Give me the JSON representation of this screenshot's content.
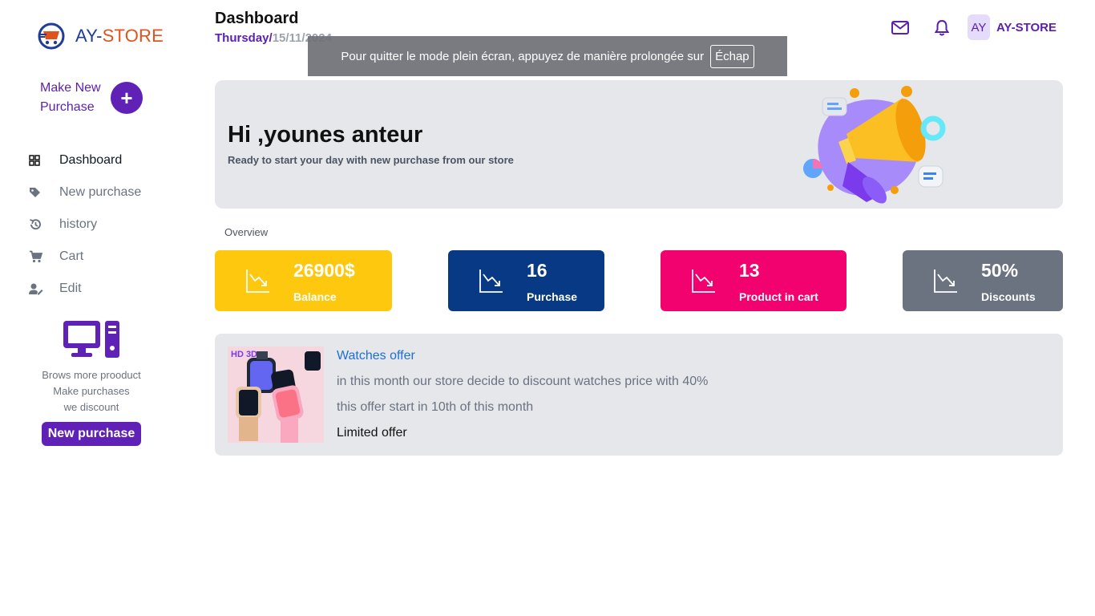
{
  "sidebar": {
    "logo": {
      "prefix": "AY-",
      "suffix": "STORE"
    },
    "make_new_label": "Make New Purchase",
    "make_new_plus": "+",
    "nav": [
      {
        "label": "Dashboard",
        "icon": "grid-icon"
      },
      {
        "label": "New purchase",
        "icon": "tag-icon"
      },
      {
        "label": "history",
        "icon": "history-icon"
      },
      {
        "label": "Cart",
        "icon": "cart-icon"
      },
      {
        "label": "Edit",
        "icon": "user-edit-icon"
      }
    ],
    "promo": {
      "line1": "Brows more prooduct",
      "line2": "Make purchases",
      "line3": "we discount",
      "button": "New purchase"
    }
  },
  "header": {
    "title": "Dashboard",
    "day": "Thursday",
    "separator": "/",
    "date": "15/11/2024",
    "avatar_initials": "AY",
    "store_name": "AY-STORE"
  },
  "toast": {
    "text": "Pour quitter le mode plein écran, appuyez de manière prolongée sur",
    "key": "Échap"
  },
  "banner": {
    "title": "Hi ,younes anteur",
    "subtitle": "Ready to start your day with new purchase from our store"
  },
  "overview": {
    "label": "Overview",
    "stats": [
      {
        "value": "26900$",
        "label": "Balance",
        "color": "#fdc80d"
      },
      {
        "value": "16",
        "label": "Purchase",
        "color": "#073985"
      },
      {
        "value": "13",
        "label": "Product in cart",
        "color": "#f2026f"
      },
      {
        "value": "50%",
        "label": "Discounts",
        "color": "#6b7280"
      }
    ]
  },
  "offer": {
    "title": "Watches offer",
    "line1": "in this month our store decide to discount watches price with 40%",
    "line2": "this offer start in 10th of this month",
    "limited": "Limited offer",
    "image_text": "HD 3D"
  },
  "colors": {
    "accent": "#5f21b6",
    "banner_bg": "#e5e7eb",
    "link": "#1d6fd6"
  }
}
